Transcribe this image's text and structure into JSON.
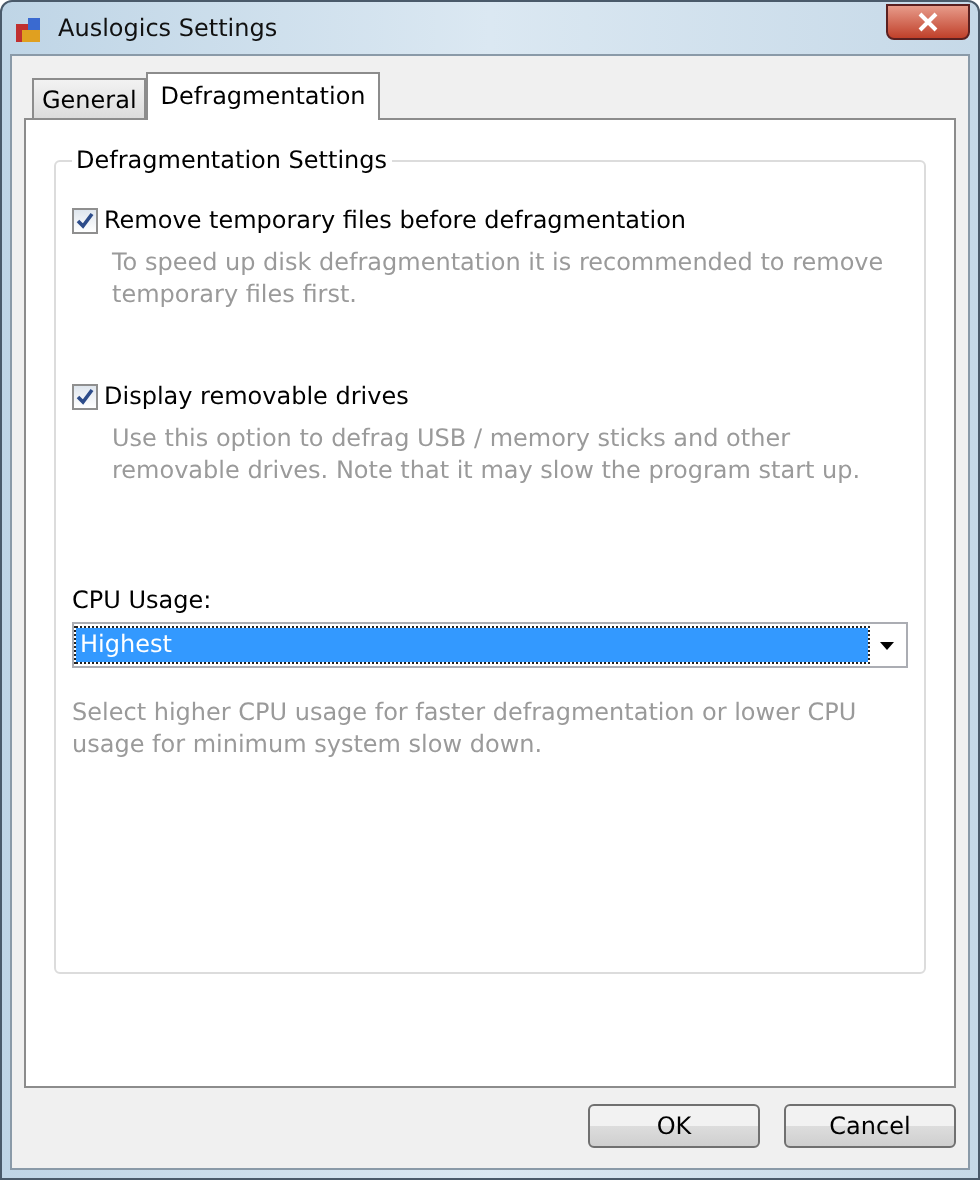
{
  "window": {
    "title": "Auslogics Settings"
  },
  "tabs": [
    {
      "label": "General",
      "selected": false
    },
    {
      "label": "Defragmentation",
      "selected": true
    }
  ],
  "group": {
    "title": "Defragmentation Settings",
    "options": [
      {
        "label": "Remove temporary files before defragmentation",
        "checked": true,
        "description": "To speed up disk defragmentation it is recommended to remove temporary files first."
      },
      {
        "label": "Display removable drives",
        "checked": true,
        "description": "Use this option to defrag USB / memory sticks and other removable drives. Note that it may slow the program start up."
      }
    ],
    "cpu": {
      "label": "CPU Usage:",
      "value": "Highest",
      "description": "Select higher CPU usage for faster defragmentation or lower CPU usage for minimum system slow down."
    }
  },
  "buttons": [
    "OK",
    "Cancel"
  ]
}
